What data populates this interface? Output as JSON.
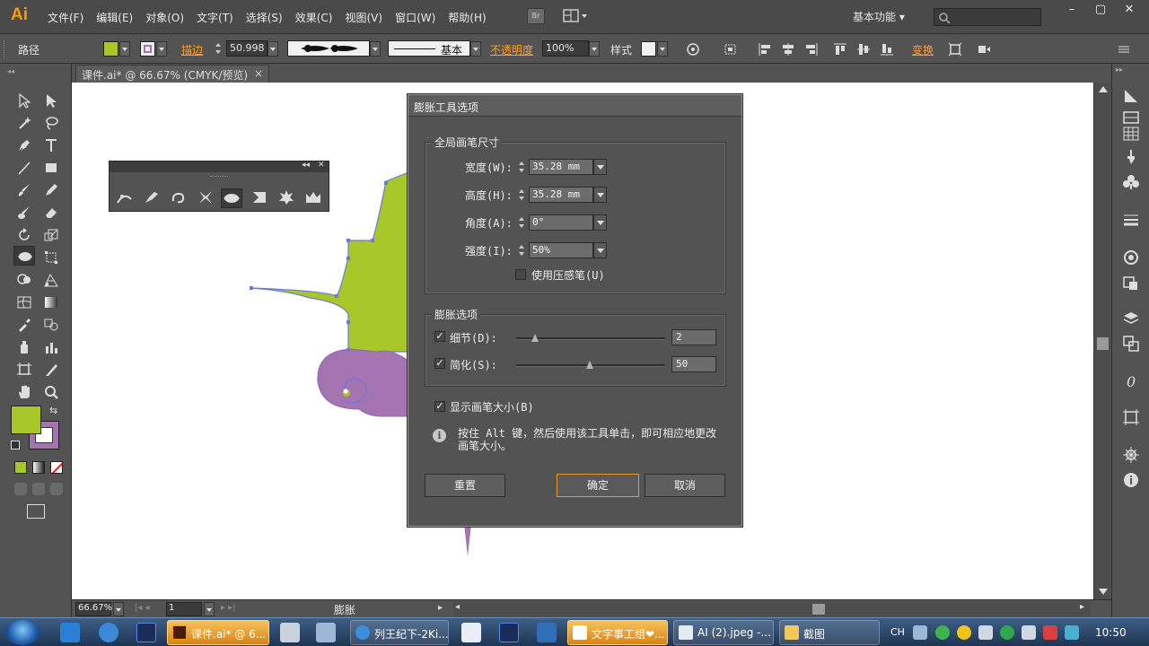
{
  "app": {
    "logo": "Ai",
    "menus": [
      "文件(F)",
      "编辑(E)",
      "对象(O)",
      "文字(T)",
      "选择(S)",
      "效果(C)",
      "视图(V)",
      "窗口(W)",
      "帮助(H)"
    ],
    "br_label": "Br",
    "workspace": "基本功能",
    "search_placeholder": ""
  },
  "controlbar": {
    "selection_type": "路径",
    "fill_color": "#a8c82a",
    "stroke_label": "描边",
    "stroke_width": "50.998",
    "stroke_style": "基本",
    "opacity_label": "不透明度",
    "opacity_value": "100%",
    "style_label": "样式",
    "transform_label": "变换"
  },
  "document": {
    "tab_title": "课件.ai* @ 66.67% (CMYK/预览)",
    "shape_fill": "#a8c82a",
    "shape_accent": "#a374b0"
  },
  "statusbar": {
    "zoom": "66.67%",
    "page": "1",
    "tool_name": "膨胀"
  },
  "dialog": {
    "title": "膨胀工具选项",
    "brush_group": "全局画笔尺寸",
    "width_label": "宽度(W):",
    "width_value": "35.28 mm",
    "height_label": "高度(H):",
    "height_value": "35.28 mm",
    "angle_label": "角度(A):",
    "angle_value": "0°",
    "intensity_label": "强度(I):",
    "intensity_value": "50%",
    "pressure_label": "使用压感笔(U)",
    "pressure_checked": false,
    "options_group": "膨胀选项",
    "detail_label": "细节(D):",
    "detail_value": "2",
    "detail_checked": true,
    "detail_level": 0.1,
    "simplify_label": "简化(S):",
    "simplify_value": "50",
    "simplify_checked": true,
    "simplify_level": 0.5,
    "show_brush_label": "显示画笔大小(B)",
    "show_brush_checked": true,
    "info_line1": "按住 Alt 键，然后使用该工具单击，即可相应地更改",
    "info_line2": "画笔大小。",
    "reset_label": "重置",
    "ok_label": "确定",
    "cancel_label": "取消"
  },
  "taskbar": {
    "tasks": [
      "课件.ai* @ 6...",
      "列王纪下-2Ki...",
      "文字事工组❤...",
      "AI (2).jpeg -...",
      "截图"
    ],
    "tray_lang": "CH",
    "clock": "10:50"
  }
}
